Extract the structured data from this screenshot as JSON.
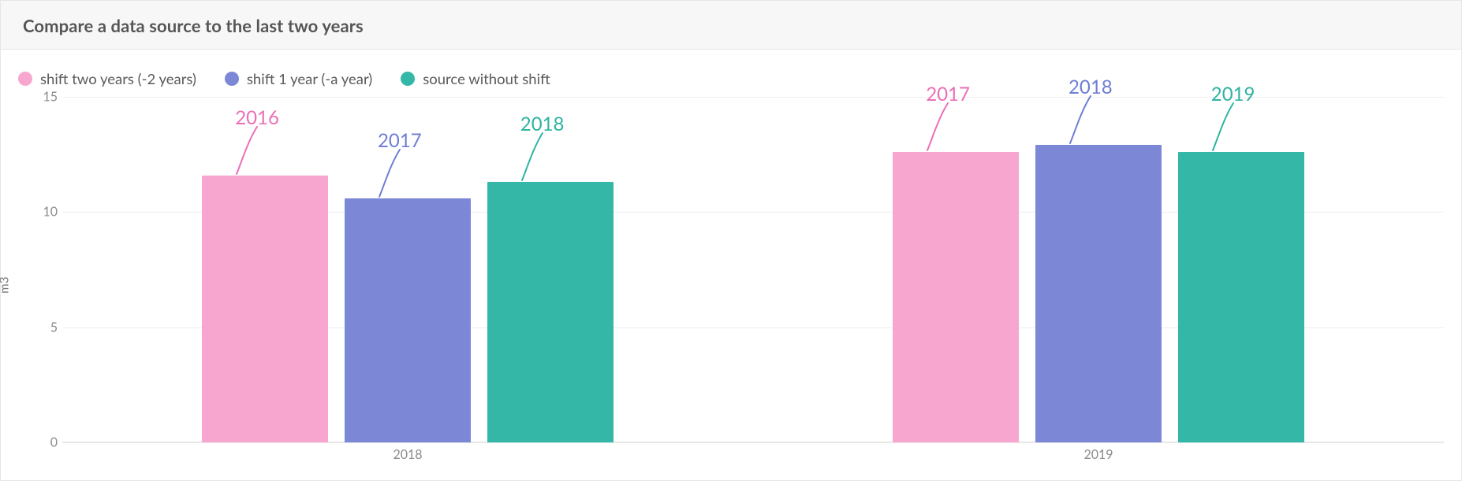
{
  "header": {
    "title": "Compare a data source to the last two years"
  },
  "legend": {
    "items": [
      {
        "label": "shift two years (-2 years)",
        "color": "#f7a7cf"
      },
      {
        "label": "shift 1 year (-a year)",
        "color": "#7c88d6"
      },
      {
        "label": "source without shift",
        "color": "#34b7a7"
      }
    ]
  },
  "yaxis": {
    "unit_label": "m3",
    "ticks": [
      "0",
      "5",
      "10",
      "15"
    ]
  },
  "xaxis": {
    "ticks": [
      "2018",
      "2019"
    ]
  },
  "annotations": {
    "group0": {
      "pink": "2016",
      "blue": "2017",
      "teal": "2018"
    },
    "group1": {
      "pink": "2017",
      "blue": "2018",
      "teal": "2019"
    }
  },
  "chart_data": {
    "type": "bar",
    "title": "Compare a data source to the last two years",
    "xlabel": "",
    "ylabel": "m3",
    "ylim": [
      0,
      15
    ],
    "categories": [
      "2018",
      "2019"
    ],
    "series": [
      {
        "name": "shift two years (-2 years)",
        "color": "#f7a7cf",
        "values": [
          11.6,
          12.6
        ],
        "bar_labels": [
          "2016",
          "2017"
        ]
      },
      {
        "name": "shift 1 year (-a year)",
        "color": "#7c88d6",
        "values": [
          10.6,
          12.9
        ],
        "bar_labels": [
          "2017",
          "2018"
        ]
      },
      {
        "name": "source without shift",
        "color": "#34b7a7",
        "values": [
          11.3,
          12.6
        ],
        "bar_labels": [
          "2018",
          "2019"
        ]
      }
    ],
    "legend_position": "top-left",
    "grid": true
  }
}
